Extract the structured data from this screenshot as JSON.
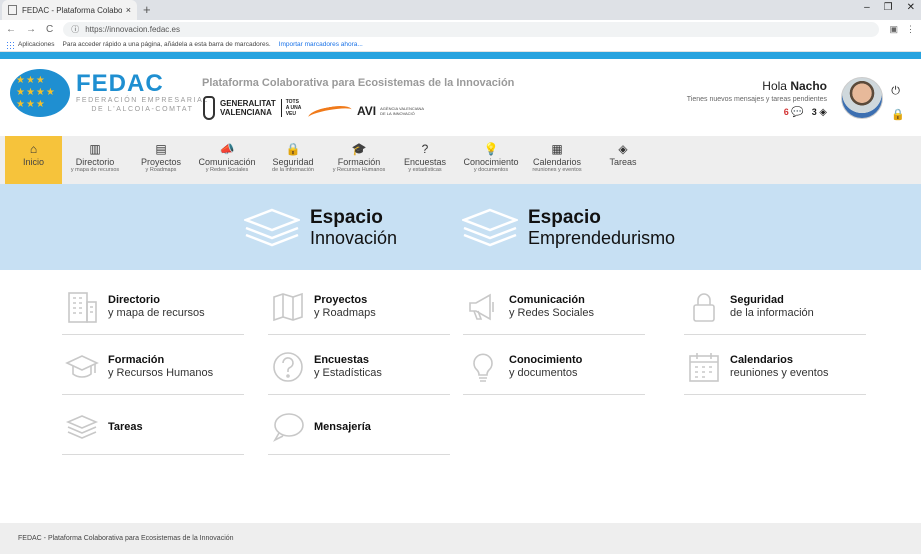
{
  "browser": {
    "tab_title": "FEDAC - Plataforma Colaborativ",
    "tab_close": "×",
    "new_tab": "+",
    "url": "https://innovacion.fedac.es",
    "bookmarks_apps": "Aplicaciones",
    "bookmarks_hint": "Para acceder rápido a una página, añádela a esta barra de marcadores.",
    "bookmarks_import": "Importar marcadores ahora..."
  },
  "header": {
    "logo_name": "FEDAC",
    "logo_sub1": "FEDERACIÓN EMPRESARIAL",
    "logo_sub2": "DE L'ALCOIA-COMTAT",
    "platform_title": "Plataforma Colaborativa para Ecosistemas de la Innovación",
    "gv_line1": "GENERALITAT",
    "gv_line2": "VALENCIANA",
    "gv_tots1": "TOTS",
    "gv_tots2": "A UNA",
    "gv_tots3": "VEU",
    "avi_name": "AVI",
    "avi_sub1": "AGÈNCIA VALENCIANA",
    "avi_sub2": "DE LA INNOVACIÓ",
    "greeting": "Hola",
    "user_name": "Nacho",
    "notice": "Tienes nuevos mensajes y tareas pendientes",
    "messages_count": "6",
    "tasks_count": "3"
  },
  "nav": [
    {
      "label": "Inicio",
      "sub": "",
      "icon": "home-icon",
      "glyph": "⌂"
    },
    {
      "label": "Directorio",
      "sub": "y mapa de recursos",
      "icon": "building-icon",
      "glyph": "▥"
    },
    {
      "label": "Proyectos",
      "sub": "y Roadmaps",
      "icon": "map-icon",
      "glyph": "▤"
    },
    {
      "label": "Comunicación",
      "sub": "y Redes Sociales",
      "icon": "megaphone-icon",
      "glyph": "📣"
    },
    {
      "label": "Seguridad",
      "sub": "de la información",
      "icon": "lock-icon",
      "glyph": "🔒"
    },
    {
      "label": "Formación",
      "sub": "y Recursos Humanos",
      "icon": "graduation-cap-icon",
      "glyph": "🎓"
    },
    {
      "label": "Encuestas",
      "sub": "y estadísticas",
      "icon": "question-icon",
      "glyph": "?"
    },
    {
      "label": "Conocimiento",
      "sub": "y documentos",
      "icon": "lightbulb-icon",
      "glyph": "💡"
    },
    {
      "label": "Calendarios",
      "sub": "reuniones y eventos",
      "icon": "calendar-icon",
      "glyph": "▦"
    },
    {
      "label": "Tareas",
      "sub": "",
      "icon": "layers-icon",
      "glyph": "◈"
    }
  ],
  "banner": {
    "espacio1_title": "Espacio",
    "espacio1_sub": "Innovación",
    "espacio2_title": "Espacio",
    "espacio2_sub": "Emprendedurismo"
  },
  "modules": [
    {
      "title": "Directorio",
      "sub": "y mapa de recursos",
      "icon": "building-icon"
    },
    {
      "title": "Proyectos",
      "sub": "y Roadmaps",
      "icon": "map-icon"
    },
    {
      "title": "Comunicación",
      "sub": "y Redes Sociales",
      "icon": "megaphone-icon"
    },
    {
      "title": "Seguridad",
      "sub": "de la información",
      "icon": "lock-icon"
    },
    {
      "title": "Formación",
      "sub": "y Recursos Humanos",
      "icon": "graduation-cap-icon"
    },
    {
      "title": "Encuestas",
      "sub": "y Estadísticas",
      "icon": "question-icon"
    },
    {
      "title": "Conocimiento",
      "sub": "y documentos",
      "icon": "lightbulb-icon"
    },
    {
      "title": "Calendarios",
      "sub": "reuniones y eventos",
      "icon": "calendar-icon"
    },
    {
      "title": "Tareas",
      "sub": "",
      "icon": "layers-icon"
    },
    {
      "title": "Mensajería",
      "sub": "",
      "icon": "chat-bubble-icon"
    }
  ],
  "footer": {
    "text": "FEDAC - Plataforma Colaborativa para Ecosistemas de la Innovación"
  },
  "colors": {
    "brand_blue": "#1f8fd1",
    "accent_yellow": "#f6c33b",
    "banner_blue": "#c7e0f3",
    "stripe_blue": "#27a3df"
  }
}
